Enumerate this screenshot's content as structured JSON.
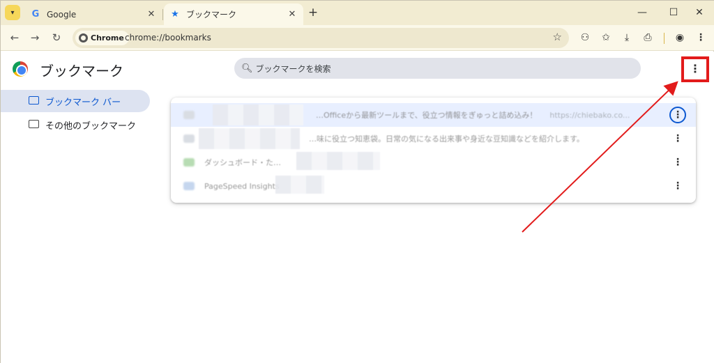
{
  "tabs": [
    {
      "title": "Google",
      "favicon": "google-g-icon",
      "active": false
    },
    {
      "title": "ブックマーク",
      "favicon": "star-icon",
      "active": true
    }
  ],
  "toolbar": {
    "chip_label": "Chrome",
    "url": "chrome://bookmarks"
  },
  "app": {
    "title": "ブックマーク",
    "search_placeholder": "ブックマークを検索"
  },
  "sidebar": {
    "items": [
      {
        "label": "ブックマーク バー",
        "selected": true
      },
      {
        "label": "その他のブックマーク",
        "selected": false
      }
    ]
  },
  "bookmarks": [
    {
      "title": "…Officeから最新ツールまで、役立つ情報をぎゅっと詰め込み！",
      "url": "https://chiebako.co..."
    },
    {
      "title": "…味に役立つ知恵袋。日常の気になる出来事や身近な豆知識などを紹介します。",
      "url": ""
    },
    {
      "title": "ダッシュボード・た…",
      "url": ""
    },
    {
      "title": "PageSpeed Insights",
      "url": ""
    }
  ],
  "colors": {
    "tabstrip": "#f2ecd2",
    "toolbar": "#fbf8e9",
    "accent": "#0b57d0",
    "annotation": "#e21b1b"
  }
}
